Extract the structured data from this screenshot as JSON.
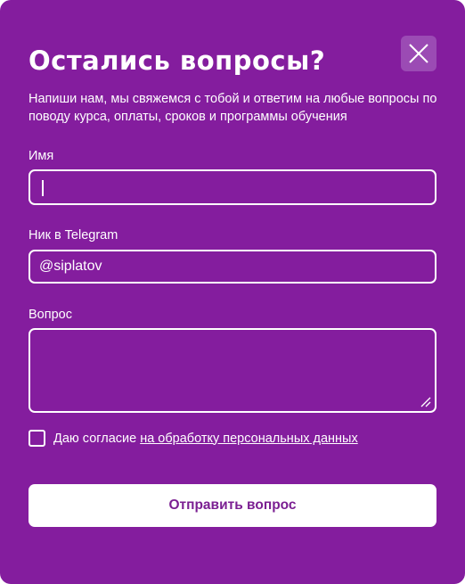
{
  "modal": {
    "title": "Остались вопросы?",
    "subtitle": "Напиши нам, мы свяжемся с тобой и ответим на любые вопросы по поводу курса, оплаты, сроков и программы обучения",
    "close_icon": "close-icon"
  },
  "form": {
    "name": {
      "label": "Имя",
      "value": ""
    },
    "telegram": {
      "label": "Ник в Telegram",
      "value": "@siplatov"
    },
    "question": {
      "label": "Вопрос",
      "value": ""
    },
    "consent": {
      "text": "Даю согласие",
      "link": "на обработку персональных данных",
      "checked": false
    },
    "submit_label": "Отправить вопрос"
  },
  "colors": {
    "background": "#841d9e",
    "close_button": "#9b4bb4",
    "submit_text": "#7b1f92"
  }
}
